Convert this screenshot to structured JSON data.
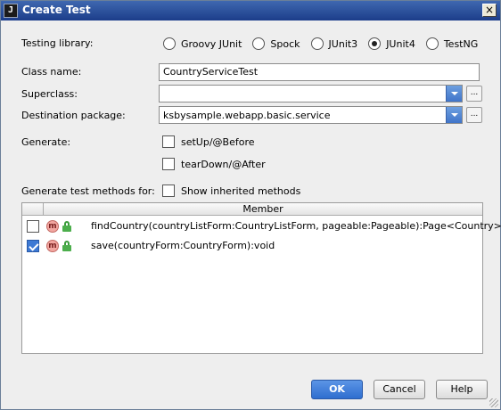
{
  "window": {
    "title": "Create Test",
    "app_icon": "J",
    "close_glyph": "×"
  },
  "testing_library": {
    "label": "Testing library:",
    "options": [
      {
        "label": "Groovy JUnit",
        "selected": false
      },
      {
        "label": "Spock",
        "selected": false
      },
      {
        "label": "JUnit3",
        "selected": false
      },
      {
        "label": "JUnit4",
        "selected": true
      },
      {
        "label": "TestNG",
        "selected": false
      }
    ]
  },
  "class_name": {
    "label": "Class name:",
    "value": "CountryServiceTest"
  },
  "superclass": {
    "label": "Superclass:",
    "value": "",
    "browse": "..."
  },
  "destination_package": {
    "label": "Destination package:",
    "value": "ksbysample.webapp.basic.service",
    "browse": "..."
  },
  "generate": {
    "label": "Generate:",
    "setup": {
      "label": "setUp/@Before",
      "checked": false
    },
    "teardown": {
      "label": "tearDown/@After",
      "checked": false
    }
  },
  "methods": {
    "label": "Generate test methods for:",
    "show_inherited": {
      "label": "Show inherited methods",
      "checked": false
    },
    "column_header": "Member",
    "rows": [
      {
        "checked": false,
        "icon": "m",
        "signature": "findCountry(countryListForm:CountryListForm, pageable:Pageable):Page<Country>"
      },
      {
        "checked": true,
        "icon": "m",
        "signature": "save(countryForm:CountryForm):void"
      }
    ]
  },
  "buttons": {
    "ok": "OK",
    "cancel": "Cancel",
    "help": "Help"
  },
  "colors": {
    "title_bar": "#1c3d8a",
    "accent": "#3f74c9",
    "method_icon": "#f2a6a0",
    "lock_icon": "#4cae4c"
  }
}
